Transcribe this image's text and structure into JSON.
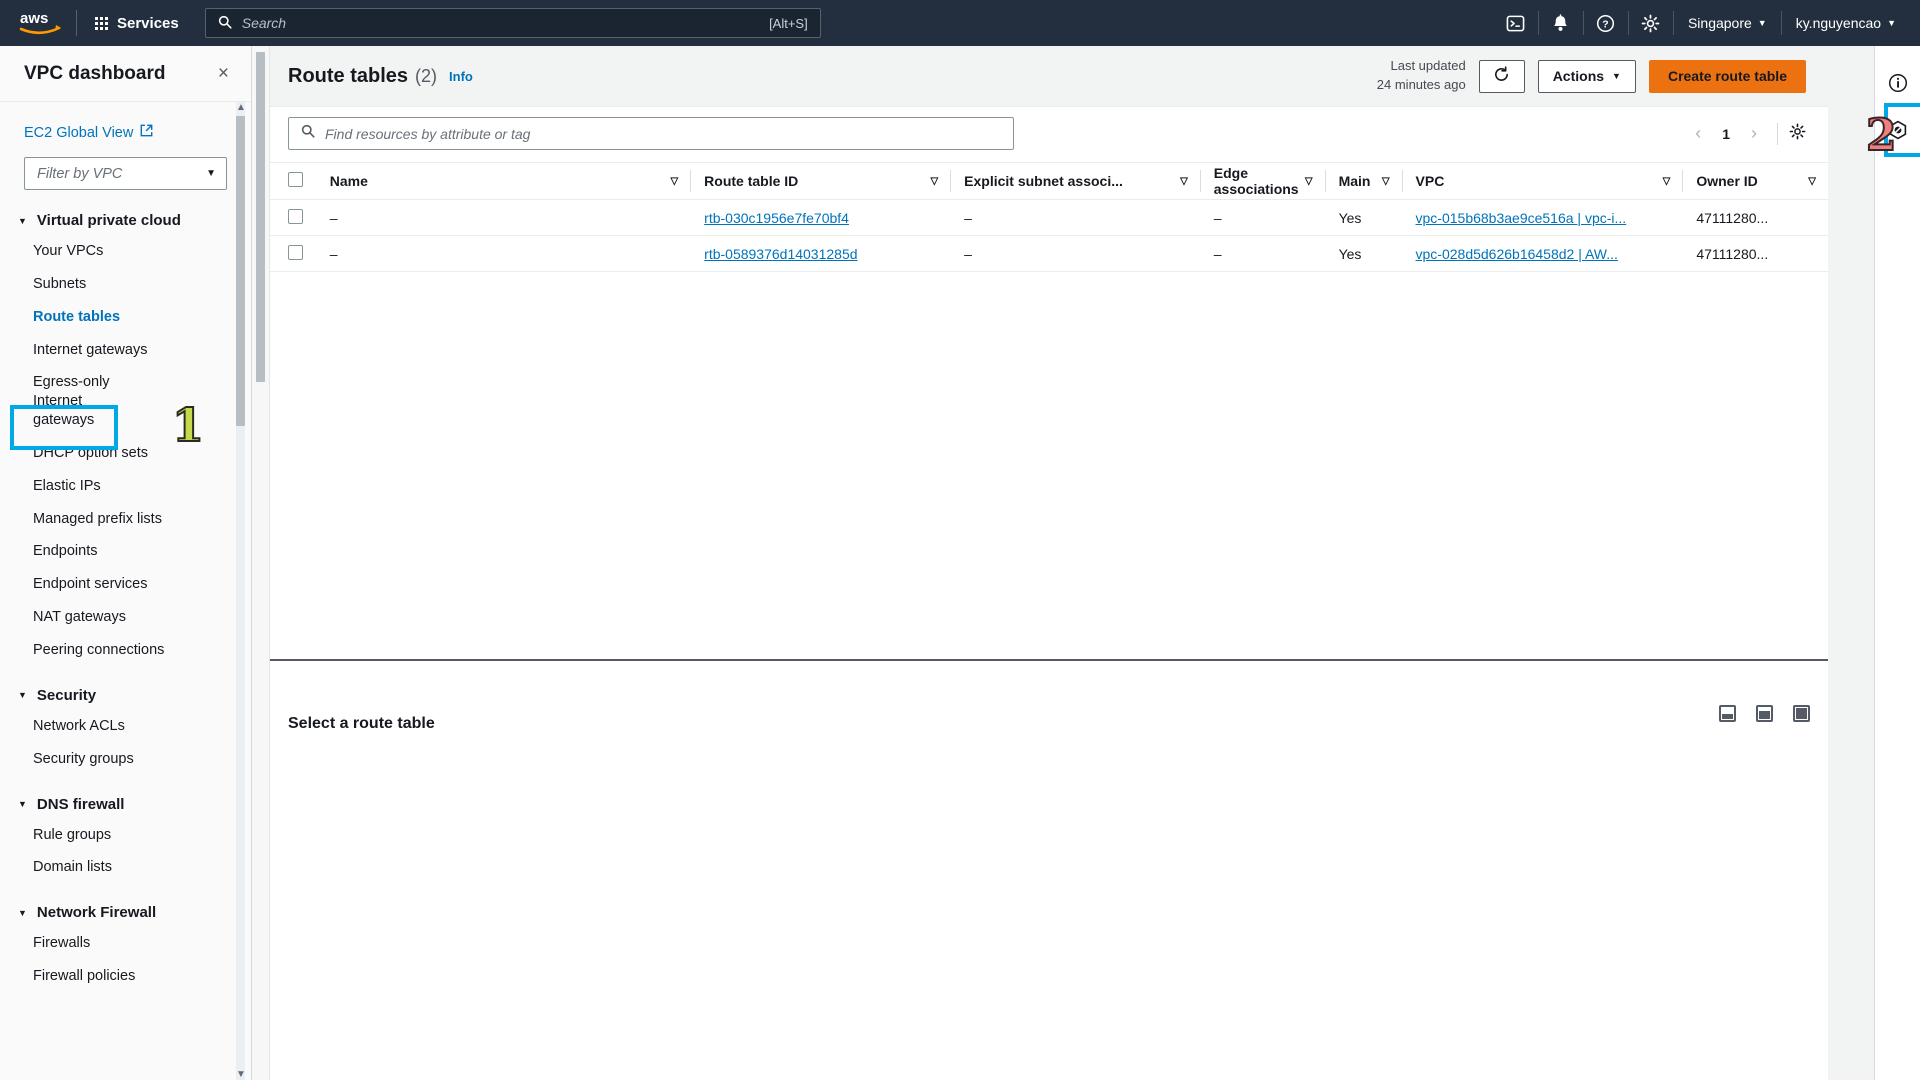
{
  "topnav": {
    "logo": "aws-logo",
    "services_label": "Services",
    "search": {
      "placeholder": "Search",
      "value": "",
      "shortcut": "[Alt+S]"
    },
    "icons": [
      "cloudshell-icon",
      "notifications-icon",
      "help-icon",
      "settings-icon"
    ],
    "region": "Singapore",
    "account": "ky.nguyencao"
  },
  "sidebar": {
    "title": "VPC dashboard",
    "close_label": "×",
    "ec2_global_view": "EC2 Global View",
    "vpc_filter_placeholder": "Filter by VPC",
    "sections": [
      {
        "label": "Virtual private cloud",
        "items": [
          {
            "label": "Your VPCs",
            "active": false
          },
          {
            "label": "Subnets",
            "active": false
          },
          {
            "label": "Route tables",
            "active": true
          },
          {
            "label": "Internet gateways",
            "active": false
          },
          {
            "label": "Egress-only Internet gateways",
            "active": false
          },
          {
            "label": "DHCP option sets",
            "active": false
          },
          {
            "label": "Elastic IPs",
            "active": false
          },
          {
            "label": "Managed prefix lists",
            "active": false
          },
          {
            "label": "Endpoints",
            "active": false
          },
          {
            "label": "Endpoint services",
            "active": false
          },
          {
            "label": "NAT gateways",
            "active": false
          },
          {
            "label": "Peering connections",
            "active": false
          }
        ]
      },
      {
        "label": "Security",
        "items": [
          {
            "label": "Network ACLs",
            "active": false
          },
          {
            "label": "Security groups",
            "active": false
          }
        ]
      },
      {
        "label": "DNS firewall",
        "items": [
          {
            "label": "Rule groups",
            "active": false
          },
          {
            "label": "Domain lists",
            "active": false
          }
        ]
      },
      {
        "label": "Network Firewall",
        "items": [
          {
            "label": "Firewalls",
            "active": false
          },
          {
            "label": "Firewall policies",
            "active": false
          }
        ]
      }
    ]
  },
  "page": {
    "title": "Route tables",
    "count": "(2)",
    "info_link": "Info",
    "last_updated_line1": "Last updated",
    "last_updated_line2": "24 minutes ago",
    "refresh_icon": "refresh-icon",
    "actions_label": "Actions",
    "create_label": "Create route table"
  },
  "table": {
    "filter_placeholder": "Find resources by attribute or tag",
    "filter_value": "",
    "pagination": {
      "prev": "‹",
      "page": "1",
      "next": "›"
    },
    "columns": [
      "Name",
      "Route table ID",
      "Explicit subnet associ...",
      "Edge associations",
      "Main",
      "VPC",
      "Owner ID"
    ],
    "rows": [
      {
        "name": "–",
        "route_table_id": "rtb-030c1956e7fe70bf4",
        "explicit_subnet_associations": "–",
        "edge_associations": "–",
        "main": "Yes",
        "vpc": "vpc-015b68b3ae9ce516a | vpc-i...",
        "owner_id": "47111280..."
      },
      {
        "name": "–",
        "route_table_id": "rtb-0589376d14031285d",
        "explicit_subnet_associations": "–",
        "edge_associations": "–",
        "main": "Yes",
        "vpc": "vpc-028d5d626b16458d2 | AW...",
        "owner_id": "47111280..."
      }
    ]
  },
  "bottom_panel": {
    "title": "Select a route table",
    "layout_icons": [
      "split-bottom-icon",
      "split-side-icon",
      "split-full-icon"
    ]
  },
  "right_rail": {
    "icons": [
      "info-icon",
      "cloudshell-hexagon-icon"
    ]
  },
  "annotations": [
    {
      "id": "1",
      "label": "1",
      "color": "#c6d94a",
      "target": "sidebar-item-route-tables"
    },
    {
      "id": "2",
      "label": "2",
      "color": "#f08080",
      "target": "create-route-table-button"
    }
  ],
  "colors": {
    "nav_bg": "#232f3e",
    "accent_orange": "#ec7211",
    "link_blue": "#0073bb",
    "highlight_blue": "#00a8e8"
  }
}
